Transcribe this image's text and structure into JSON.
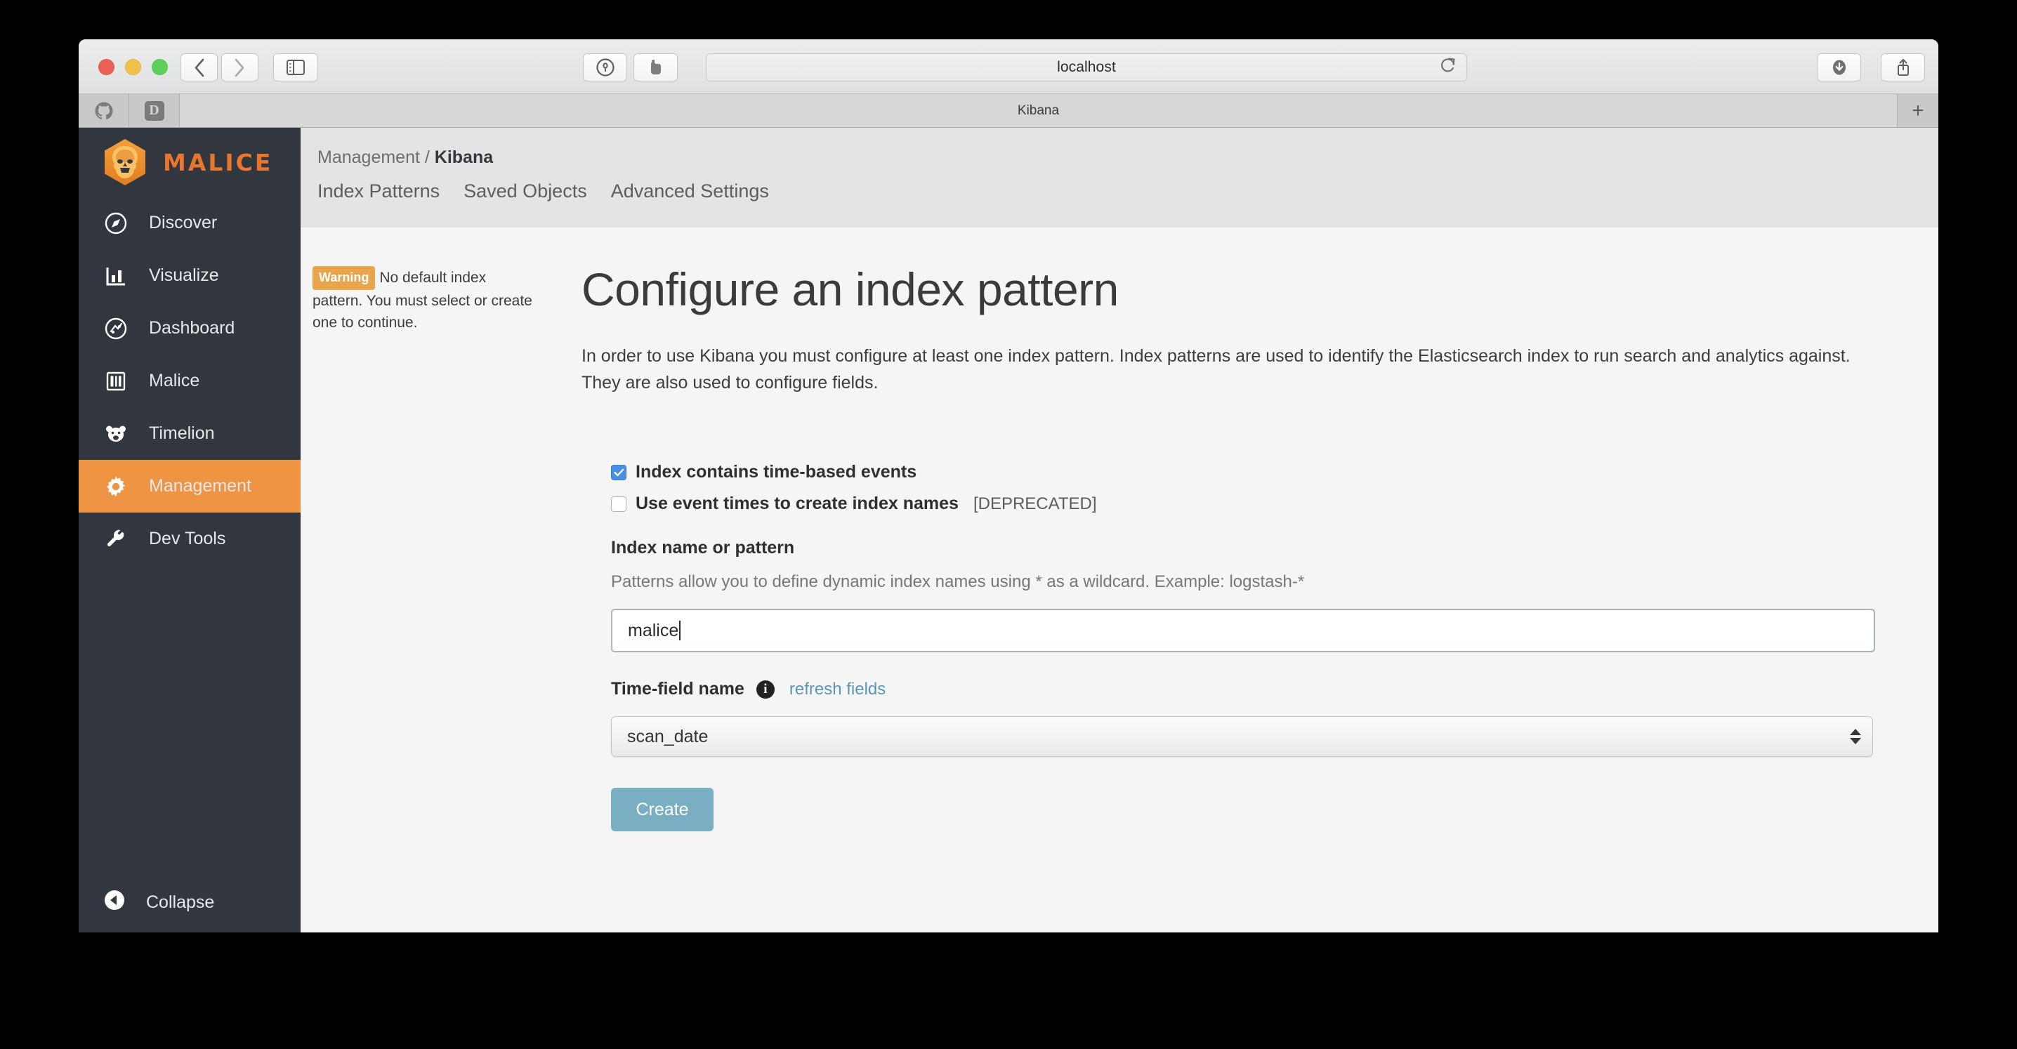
{
  "browser": {
    "url": "localhost",
    "traffic_lights": [
      "close",
      "minimize",
      "maximize"
    ],
    "back_icon": "chevron-left-icon",
    "forward_icon": "chevron-right-icon",
    "sidebar_toggle_icon": "sidebar-icon",
    "onepassword_icon": "onepassword-icon",
    "evernote_icon": "evernote-icon",
    "reload_icon": "reload-icon",
    "download_icon": "download-icon",
    "share_icon": "share-icon",
    "tabs_icon": "tab-overview-icon",
    "new_tab_label": "+",
    "tabs": [
      {
        "favicon": "github-icon",
        "title": ""
      },
      {
        "favicon": "d-favicon",
        "title": ""
      },
      {
        "favicon": "",
        "title": "Kibana",
        "active": true
      }
    ]
  },
  "sidebar": {
    "logo_text": "MALICE",
    "logo_icon": "malice-lion-hexagon-logo",
    "items": [
      {
        "label": "Discover",
        "icon": "compass-icon",
        "active": false
      },
      {
        "label": "Visualize",
        "icon": "bar-chart-icon",
        "active": false
      },
      {
        "label": "Dashboard",
        "icon": "dashboard-icon",
        "active": false
      },
      {
        "label": "Malice",
        "icon": "columns-icon",
        "active": false
      },
      {
        "label": "Timelion",
        "icon": "bear-icon",
        "active": false
      },
      {
        "label": "Management",
        "icon": "gear-icon",
        "active": true
      },
      {
        "label": "Dev Tools",
        "icon": "wrench-icon",
        "active": false
      }
    ],
    "collapse": {
      "label": "Collapse",
      "icon": "collapse-left-icon"
    }
  },
  "header": {
    "breadcrumb_root": "Management",
    "breadcrumb_sep": " / ",
    "breadcrumb_current": "Kibana",
    "tabs": [
      {
        "label": "Index Patterns",
        "active": true
      },
      {
        "label": "Saved Objects",
        "active": false
      },
      {
        "label": "Advanced Settings",
        "active": false
      }
    ]
  },
  "warning": {
    "badge": "Warning",
    "message": "No default index pattern. You must select or create one to continue."
  },
  "main": {
    "title": "Configure an index pattern",
    "intro": "In order to use Kibana you must configure at least one index pattern. Index patterns are used to identify the Elasticsearch index to run search and analytics against. They are also used to configure fields.",
    "checkbox_time_based": {
      "label": "Index contains time-based events",
      "checked": true,
      "check_glyph": "✓"
    },
    "checkbox_event_times": {
      "label": "Use event times to create index names",
      "suffix": "[DEPRECATED]",
      "checked": false
    },
    "index_name": {
      "label": "Index name or pattern",
      "help": "Patterns allow you to define dynamic index names using * as a wildcard. Example: logstash-*",
      "value": "malice",
      "placeholder": ""
    },
    "time_field": {
      "label": "Time-field name",
      "info_icon": "info-icon",
      "info_glyph": "i",
      "refresh_link": "refresh fields",
      "selected": "scan_date",
      "options": [
        "scan_date"
      ]
    },
    "create_button": "Create"
  },
  "colors": {
    "accent_orange": "#ee9443",
    "sidebar_dark": "#31363f",
    "logo_orange": "#e8762d",
    "warning_badge": "#e8a54b",
    "create_button": "#79aec3",
    "link_blue": "#5a97b5",
    "checkbox_blue": "#4a90e2",
    "header_gray": "#e4e4e4",
    "content_gray": "#f5f5f5"
  }
}
